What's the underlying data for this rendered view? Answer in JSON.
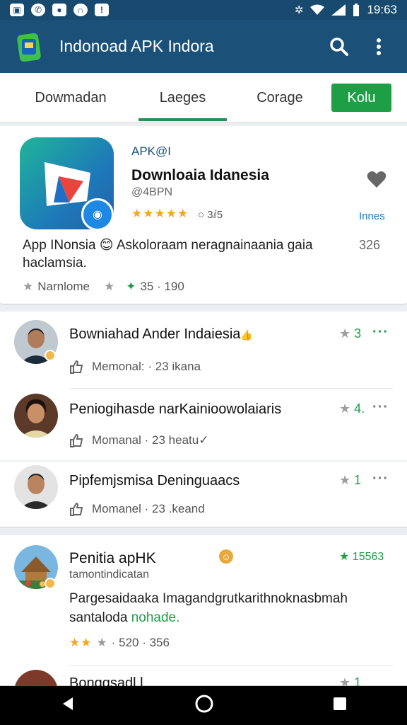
{
  "status_bar": {
    "time": "19:63"
  },
  "toolbar": {
    "title": "Indonoad APK Indora"
  },
  "tabs": [
    {
      "label": "Dowmadan"
    },
    {
      "label": "Laeges"
    },
    {
      "label": "Corage"
    }
  ],
  "tab_button": {
    "label": "Kolu"
  },
  "featured": {
    "tag": "APK@I",
    "title": "Downloaia Idanesia",
    "dev": "@4BPN",
    "rating_stars": "★★★★★",
    "rating_value": "○ 3ⅈ5",
    "side_label": "Innes",
    "description": "App INonsia 😊 Askoloraam neragnainaania gaia haclamsia.",
    "desc_num": "326",
    "meta_label": "Narnlome",
    "meta_count": "35 · 190"
  },
  "reviews": [
    {
      "name": "Bowniahad Ander Indaiesia",
      "emoji": "👍",
      "rating_star": "★",
      "rating": "3",
      "meta": "Memonal: · 23 ikana"
    },
    {
      "name": "Peniogihasde narKainioowolaiaris",
      "emoji": "",
      "rating_star": "★",
      "rating": "4.",
      "meta": "Momanal · 23 heatu✓"
    },
    {
      "name": "Pipfemjsmisa Deninguaacs",
      "emoji": "",
      "rating_star": "★",
      "rating": "1",
      "meta": "Momanel · 23 .keand"
    }
  ],
  "post": {
    "title": "Penitia apHK",
    "subtitle": "tamontindicatan",
    "rating_star": "★",
    "rating_value": "15563",
    "body_main": "Pargesaidaaka Imagandgrutkarithnoknasbmah santaloda ",
    "body_link": "nohade.",
    "stars": "★★",
    "star_empty": "★",
    "meta": "· 520 · 356"
  },
  "next_item": {
    "name": "Bonggsadl l",
    "rating": "1"
  },
  "colors": {
    "toolbar": "#1b5178",
    "accent_green": "#1e9e45",
    "star_orange": "#f5a623"
  }
}
